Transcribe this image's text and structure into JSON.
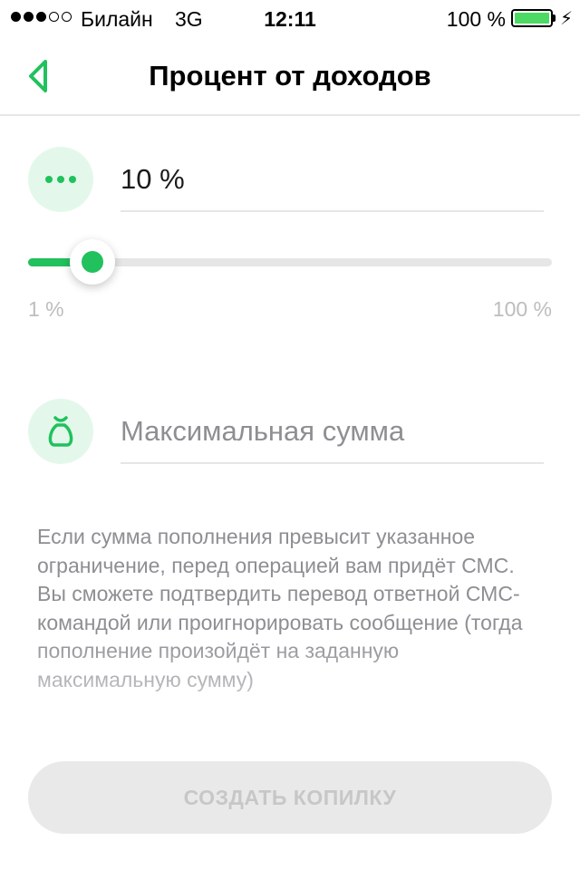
{
  "status_bar": {
    "carrier": "Билайн",
    "network": "3G",
    "time": "12:11",
    "battery_percent": "100 %",
    "battery_level": 1.0,
    "signal_bars_filled": 3,
    "signal_bars_total": 5
  },
  "nav": {
    "title": "Процент от доходов",
    "back_icon": "chevron-left-icon"
  },
  "percent_field": {
    "icon": "more-dots-icon",
    "value": "10 %"
  },
  "slider": {
    "value_percent": 10,
    "min_label": "1 %",
    "max_label": "100 %"
  },
  "max_sum_field": {
    "icon": "money-bag-icon",
    "placeholder": "Максимальная сумма"
  },
  "info_text": "Если сумма пополнения превысит указанное ограничение, перед операцией вам придёт СМС. Вы сможете подтвердить перевод ответной СМС-командой или проигнорировать сообщение (тогда пополнение произойдёт на заданную максимальную сумму)",
  "create_button": {
    "label": "СОЗДАТЬ КОПИЛКУ",
    "enabled": false
  },
  "colors": {
    "accent": "#21c15e",
    "icon_bg": "#e3f8ea",
    "battery": "#4cd964",
    "disabled_button": "#e9e9e9"
  }
}
